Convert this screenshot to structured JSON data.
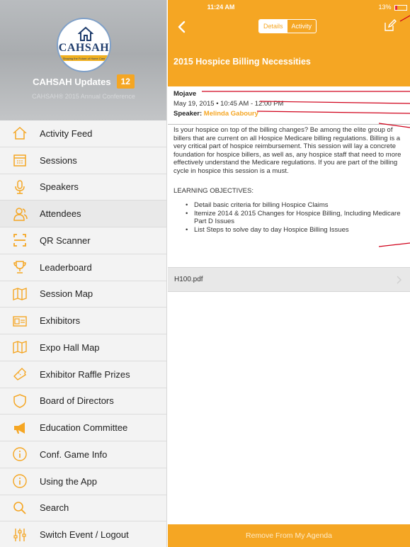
{
  "sidebar": {
    "logo_text": "CAHSAH",
    "logo_tagline": "Shaping the Future of Home Care",
    "title": "CAHSAH Updates",
    "badge": "12",
    "subtitle": "CAHSAH® 2015 Annual Conference",
    "items": [
      {
        "label": "Activity Feed",
        "icon": "home-icon"
      },
      {
        "label": "Sessions",
        "icon": "calendar-icon"
      },
      {
        "label": "Speakers",
        "icon": "microphone-icon"
      },
      {
        "label": "Attendees",
        "icon": "people-icon"
      },
      {
        "label": "QR Scanner",
        "icon": "qr-scanner-icon"
      },
      {
        "label": "Leaderboard",
        "icon": "trophy-icon"
      },
      {
        "label": "Session Map",
        "icon": "map-icon"
      },
      {
        "label": "Exhibitors",
        "icon": "id-card-icon"
      },
      {
        "label": "Expo Hall Map",
        "icon": "map-icon"
      },
      {
        "label": "Exhibitor Raffle Prizes",
        "icon": "ticket-icon"
      },
      {
        "label": "Board of Directors",
        "icon": "shield-icon"
      },
      {
        "label": "Education Committee",
        "icon": "megaphone-icon"
      },
      {
        "label": "Conf. Game Info",
        "icon": "info-icon"
      },
      {
        "label": "Using the App",
        "icon": "info-icon"
      },
      {
        "label": "Search",
        "icon": "search-icon"
      },
      {
        "label": "Switch Event / Logout",
        "icon": "sliders-icon"
      }
    ]
  },
  "status": {
    "time": "11:24 AM",
    "battery": "13%"
  },
  "main": {
    "tabs": [
      {
        "label": "Details",
        "active": true
      },
      {
        "label": "Activity",
        "active": false
      }
    ],
    "session_title": "2015 Hospice Billing Necessities",
    "location": "Mojave",
    "datetime": "May 19, 2015  •  10:45 AM - 12:00 PM",
    "speaker_label": "Speaker:",
    "speaker_name": "Melinda Gaboury",
    "description": "Is your hospice on top of the billing changes? Be among the elite group of billers that are current on all Hospice Medicare billing regulations. Billing is a very critical part of hospice reimbursement. This session will lay a concrete foundation for hospice billers, as well as, any hospice staff that need to more effectively understand the Medicare regulations. If you are part of the billing cycle in hospice this session is a must.",
    "objectives_title": "LEARNING OBJECTIVES:",
    "objectives": [
      "Detail basic criteria for billing Hospice Claims",
      "Itemize 2014 & 2015 Changes for Hospice Billing, Including Medicare Part D Issues",
      "List Steps to solve day to day Hospice Billing Issues"
    ],
    "file": "H100.pdf",
    "bottom_action": "Remove From My Agenda"
  },
  "colors": {
    "accent": "#f5a623",
    "annotation": "#d0021b",
    "sidebar_bg": "#f0f0f0"
  }
}
